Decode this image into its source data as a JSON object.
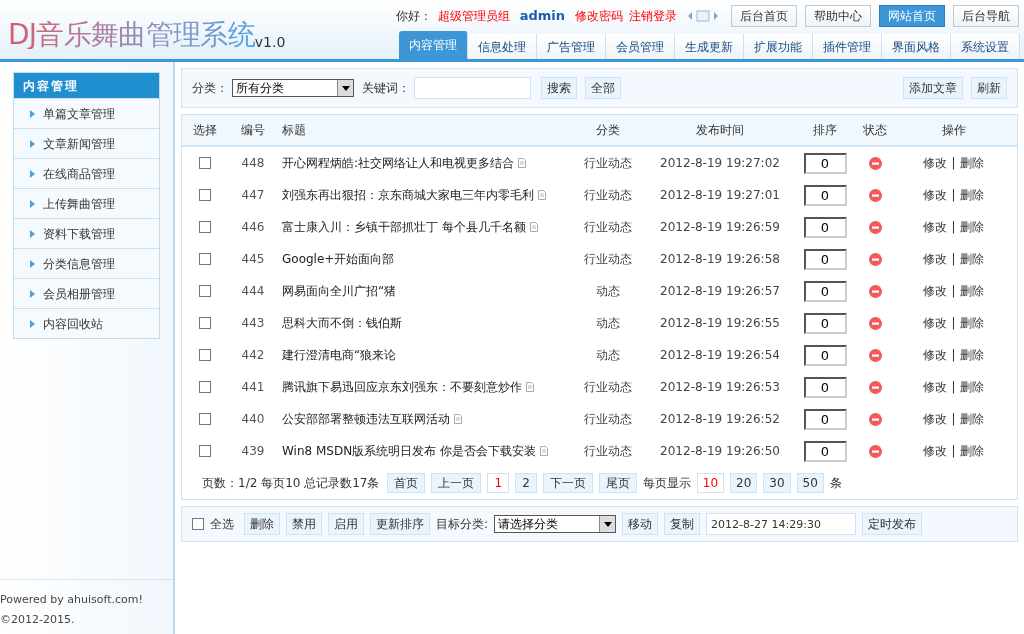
{
  "logo": {
    "title": "DJ音乐舞曲管理系统",
    "version": "v1.0"
  },
  "user_bar": {
    "greeting": "你好：",
    "group": "超级管理员组",
    "username": "admin",
    "links": [
      "修改密码",
      "注销登录"
    ]
  },
  "top_buttons": [
    {
      "label": "后台首页",
      "selected": false
    },
    {
      "label": "帮助中心",
      "selected": false
    },
    {
      "label": "网站首页",
      "selected": true
    },
    {
      "label": "后台导航",
      "selected": false
    }
  ],
  "tabs": [
    {
      "label": "内容管理",
      "selected": true
    },
    {
      "label": "信息处理",
      "selected": false
    },
    {
      "label": "广告管理",
      "selected": false
    },
    {
      "label": "会员管理",
      "selected": false
    },
    {
      "label": "生成更新",
      "selected": false
    },
    {
      "label": "扩展功能",
      "selected": false
    },
    {
      "label": "插件管理",
      "selected": false
    },
    {
      "label": "界面风格",
      "selected": false
    },
    {
      "label": "系统设置",
      "selected": false
    }
  ],
  "sidebar": {
    "title": "内容管理",
    "items": [
      "单篇文章管理",
      "文章新闻管理",
      "在线商品管理",
      "上传舞曲管理",
      "资料下载管理",
      "分类信息管理",
      "会员相册管理",
      "内容回收站"
    ]
  },
  "footer": [
    "Powered by ahuisoft.com!",
    "©2012-2015."
  ],
  "filter": {
    "category_label": "分类：",
    "category_value": "所有分类",
    "keyword_label": "关键词：",
    "buttons": [
      "搜索",
      "全部"
    ],
    "right_buttons": [
      "添加文章",
      "刷新"
    ]
  },
  "table": {
    "columns": [
      "选择",
      "编号",
      "标题",
      "分类",
      "发布时间",
      "排序",
      "状态",
      "操作"
    ],
    "rows": [
      {
        "id": "448",
        "title": "开心网程炳皓:社交网络让人和电视更多结合",
        "doc_icon": true,
        "category": "行业动态",
        "time": "2012-8-19 19:27:02",
        "order": "0",
        "checked": false,
        "actions": [
          "修改",
          "|",
          "删除"
        ]
      },
      {
        "id": "447",
        "title": "刘强东再出狠招：京东商城大家电三年内零毛利",
        "doc_icon": true,
        "category": "行业动态",
        "time": "2012-8-19 19:27:01",
        "order": "0",
        "checked": false,
        "actions": [
          "修改",
          "|",
          "删除"
        ]
      },
      {
        "id": "446",
        "title": "富士康入川：乡镇干部抓壮丁 每个县几千名额",
        "doc_icon": true,
        "category": "行业动态",
        "time": "2012-8-19 19:26:59",
        "order": "0",
        "checked": false,
        "actions": [
          "修改",
          "|",
          "删除"
        ]
      },
      {
        "id": "445",
        "title": "Google+开始面向部",
        "doc_icon": false,
        "category": "行业动态",
        "time": "2012-8-19 19:26:58",
        "order": "0",
        "checked": false,
        "actions": [
          "修改",
          "|",
          "删除"
        ]
      },
      {
        "id": "444",
        "title": "网易面向全川广招“猪",
        "doc_icon": false,
        "category": "动态",
        "time": "2012-8-19 19:26:57",
        "order": "0",
        "checked": false,
        "actions": [
          "修改",
          "|",
          "删除"
        ]
      },
      {
        "id": "443",
        "title": "思科大而不倒：钱伯斯",
        "doc_icon": false,
        "category": "动态",
        "time": "2012-8-19 19:26:55",
        "order": "0",
        "checked": false,
        "actions": [
          "修改",
          "|",
          "删除"
        ]
      },
      {
        "id": "442",
        "title": "建行澄清电商“狼来论",
        "doc_icon": false,
        "category": "动态",
        "time": "2012-8-19 19:26:54",
        "order": "0",
        "checked": false,
        "actions": [
          "修改",
          "|",
          "删除"
        ]
      },
      {
        "id": "441",
        "title": "腾讯旗下易迅回应京东刘强东：不要刻意炒作",
        "doc_icon": true,
        "category": "行业动态",
        "time": "2012-8-19 19:26:53",
        "order": "0",
        "checked": false,
        "actions": [
          "修改",
          "|",
          "删除"
        ]
      },
      {
        "id": "440",
        "title": "公安部部署整顿违法互联网活动",
        "doc_icon": true,
        "category": "行业动态",
        "time": "2012-8-19 19:26:52",
        "order": "0",
        "checked": false,
        "actions": [
          "修改",
          "|",
          "删除"
        ]
      },
      {
        "id": "439",
        "title": "Win8 MSDN版系统明日发布 你是否会下载安装",
        "doc_icon": true,
        "category": "行业动态",
        "time": "2012-8-19 19:26:50",
        "order": "0",
        "checked": false,
        "actions": [
          "修改",
          "|",
          "删除"
        ]
      }
    ]
  },
  "pager": {
    "info": "页数：1/2 每页10 总记录数17条",
    "nav": [
      {
        "label": "首页",
        "selected": false
      },
      {
        "label": "上一页",
        "selected": false
      },
      {
        "label": "1",
        "selected": true
      },
      {
        "label": "2",
        "selected": false
      },
      {
        "label": "下一页",
        "selected": false
      },
      {
        "label": "尾页",
        "selected": false
      }
    ],
    "per_page_label": "每页显示",
    "per_page": [
      {
        "label": "10",
        "selected": true
      },
      {
        "label": "20",
        "selected": false
      },
      {
        "label": "30",
        "selected": false
      },
      {
        "label": "50",
        "selected": false
      }
    ],
    "unit": "条"
  },
  "bulk": {
    "select_all": "全选",
    "select_all_checked": false,
    "buttons": [
      "删除",
      "禁用",
      "启用",
      "更新排序"
    ],
    "target_label": "目标分类:",
    "target_value": "请选择分类",
    "buttons2": [
      "移动",
      "复制"
    ],
    "datetime": "2012-8-27 14:29:30",
    "publish": "定时发布"
  }
}
